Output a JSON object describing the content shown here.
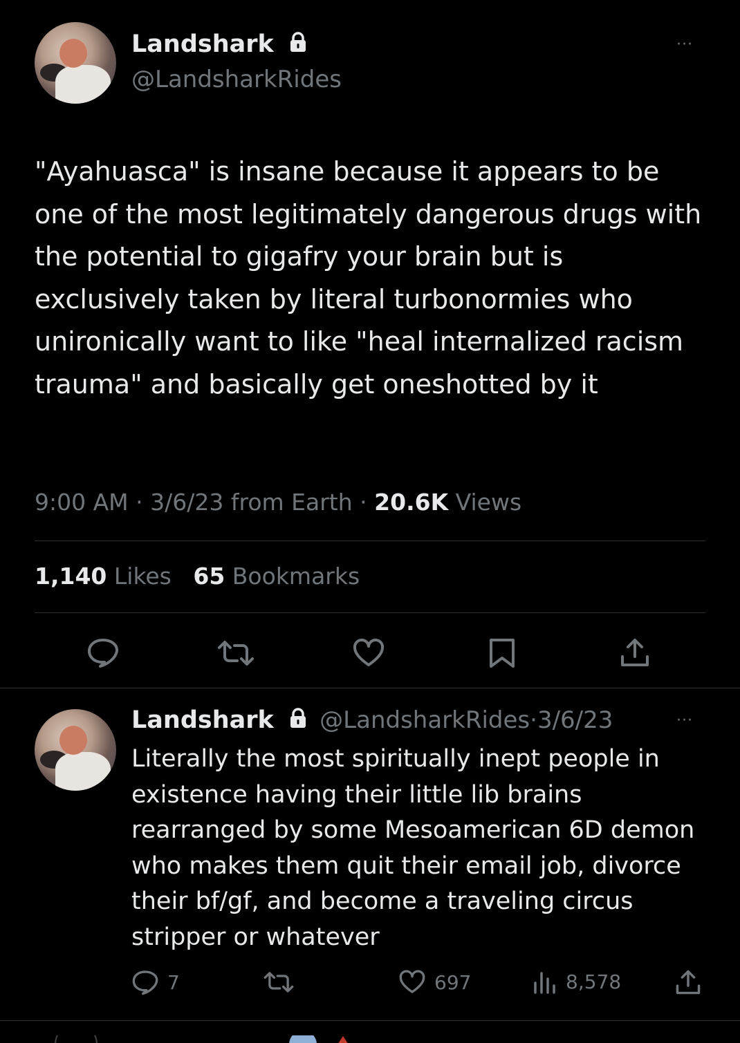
{
  "main_tweet": {
    "display_name": "Landshark",
    "handle": "@LandsharkRides",
    "text": "\"Ayahuasca\" is insane because it appears to be one of the most legitimately dangerous drugs with the potential to gigafry your brain but is exclusively taken by literal turbonormies who unironically want to like \"heal internalized racism trauma\" and basically get oneshotted by it",
    "time": "9:00 AM",
    "date": "3/6/23",
    "source": "from Earth",
    "views_count": "20.6K",
    "views_label": "Views",
    "likes_count": "1,140",
    "likes_label": "Likes",
    "bookmarks_count": "65",
    "bookmarks_label": "Bookmarks",
    "separator": "·",
    "more_label": "···"
  },
  "reply_tweet": {
    "display_name": "Landshark",
    "handle": "@LandsharkRides",
    "separator": "·",
    "date": "3/6/23",
    "text": "Literally the most spiritually inept people in existence having their little lib brains rearranged by some Mesoamerican 6D demon who makes them quit their email job, divorce their bf/gf, and become a traveling circus stripper or whatever",
    "reply_count": "7",
    "like_count": "697",
    "view_count": "8,578",
    "more_label": "···"
  },
  "icons": {
    "lock": "lock-icon",
    "reply": "reply-icon",
    "retweet": "retweet-icon",
    "like": "heart-icon",
    "bookmark": "bookmark-icon",
    "share": "share-icon",
    "views": "views-icon"
  },
  "colors": {
    "background": "#000000",
    "text_primary": "#e7e9ea",
    "text_secondary": "#71767b",
    "divider": "#2f3336"
  }
}
